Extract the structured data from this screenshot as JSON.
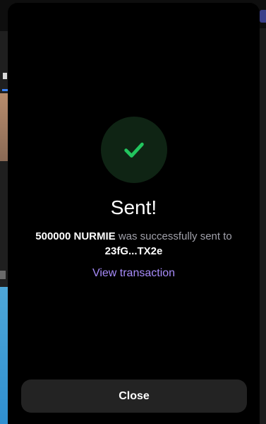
{
  "dialog": {
    "title": "Sent!",
    "amount": "500000 NURMIE",
    "message_middle": " was successfully sent to ",
    "recipient": "23fG...TX2e",
    "view_transaction_label": "View transaction",
    "close_label": "Close"
  },
  "icons": {
    "status": "checkmark-icon"
  },
  "colors": {
    "background": "#000000",
    "success_green": "#22c55e",
    "success_circle": "#0f2414",
    "link_purple": "#a78bfa",
    "button_bg": "#232323",
    "muted_text": "#a1a1aa"
  }
}
